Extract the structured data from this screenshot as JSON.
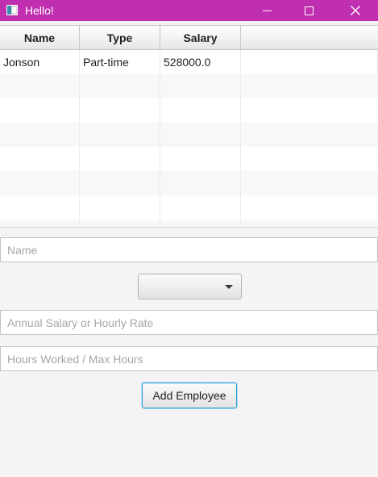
{
  "window": {
    "title": "Hello!"
  },
  "table": {
    "columns": [
      "Name",
      "Type",
      "Salary"
    ],
    "rows": [
      [
        "Jonson",
        "Part-time",
        "528000.0"
      ]
    ]
  },
  "form": {
    "name_placeholder": "Name",
    "type_selected": "",
    "salary_placeholder": "Annual Salary or Hourly Rate",
    "hours_placeholder": "Hours Worked / Max Hours",
    "add_button": "Add Employee"
  },
  "colors": {
    "titlebar": "#c02fb0",
    "button_focus": "#2a9ad8"
  }
}
